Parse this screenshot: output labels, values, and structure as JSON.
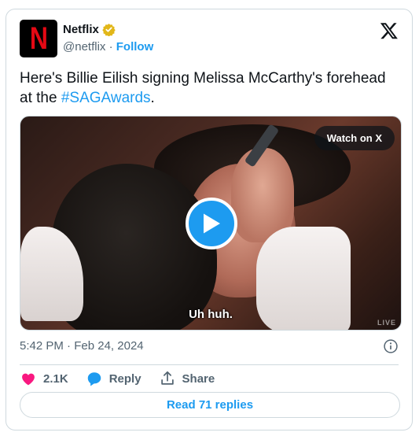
{
  "account": {
    "display_name": "Netflix",
    "handle": "@netflix",
    "separator": "·",
    "follow_label": "Follow",
    "avatar_letter": "N",
    "verified": true
  },
  "tweet": {
    "text_before": "Here's Billie Eilish signing Melissa McCarthy's forehead at the ",
    "hashtag": "#SAGAwards",
    "text_after": "."
  },
  "media": {
    "watch_label": "Watch on X",
    "caption": "Uh huh.",
    "live_mark": "LIVE"
  },
  "meta": {
    "time": "5:42 PM",
    "separator": "·",
    "date": "Feb 24, 2024"
  },
  "actions": {
    "like_count": "2.1K",
    "reply_label": "Reply",
    "share_label": "Share"
  },
  "read_replies_label": "Read 71 replies",
  "colors": {
    "accent": "#1d9bf0",
    "like": "#f91880",
    "verified": "#e2b719",
    "brand_red": "#e50914"
  }
}
